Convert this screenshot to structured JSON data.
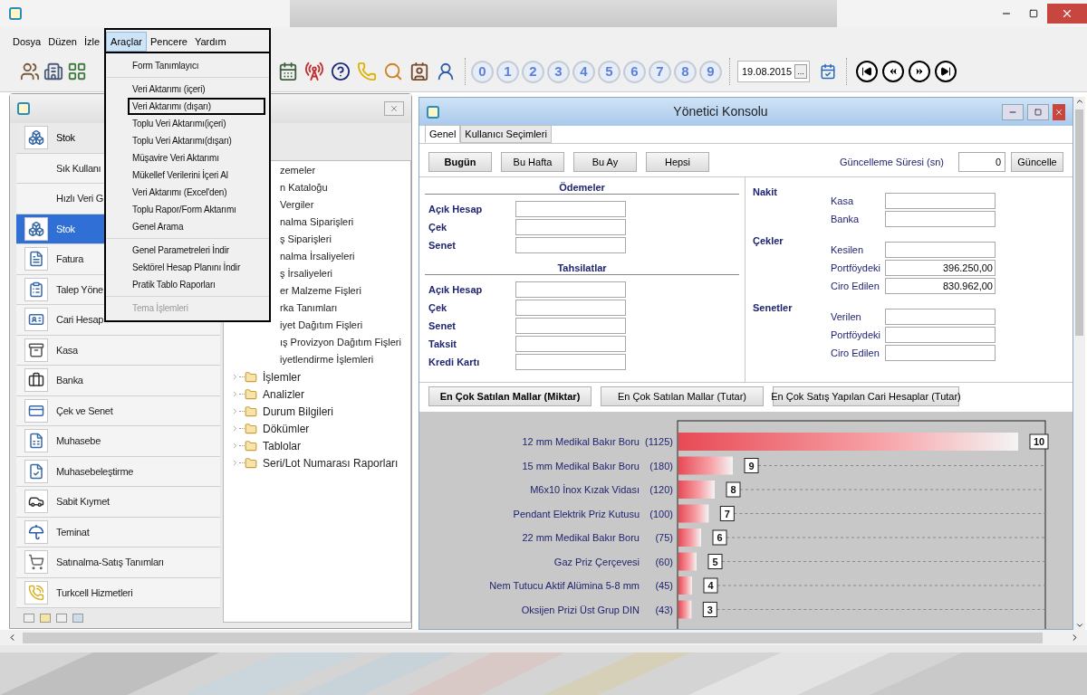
{
  "menu_bar": [
    {
      "label": "Dosya",
      "selected": false
    },
    {
      "label": "Düzen",
      "selected": false
    },
    {
      "label": "İzle",
      "selected": false
    },
    {
      "label": "Araçlar",
      "selected": true
    },
    {
      "label": "Pencere",
      "selected": false
    },
    {
      "label": "Yardım",
      "selected": false
    }
  ],
  "open_menu": {
    "groups": [
      [
        {
          "label": "Form Tanımlayıcı",
          "selected": false,
          "disabled": false
        }
      ],
      [
        {
          "label": "Veri Aktarımı (içeri)",
          "selected": false,
          "disabled": false
        },
        {
          "label": "Veri Aktarımı (dışarı)",
          "selected": true,
          "disabled": false
        },
        {
          "label": "Toplu Veri Aktarımı(içeri)",
          "selected": false,
          "disabled": false
        },
        {
          "label": "Toplu Veri Aktarımı(dışarı)",
          "selected": false,
          "disabled": false
        },
        {
          "label": "Müşavire Veri Aktarımı",
          "selected": false,
          "disabled": false
        },
        {
          "label": "Mükellef Verilerini İçeri Al",
          "selected": false,
          "disabled": false
        },
        {
          "label": "Veri Aktarımı (Excel'den)",
          "selected": false,
          "disabled": false
        },
        {
          "label": "Toplu Rapor/Form Aktarımı",
          "selected": false,
          "disabled": false
        },
        {
          "label": "Genel Arama",
          "selected": false,
          "disabled": false
        }
      ],
      [
        {
          "label": "Genel Parametreleri İndir",
          "selected": false,
          "disabled": false
        },
        {
          "label": "Sektörel Hesap Planını İndir",
          "selected": false,
          "disabled": false
        },
        {
          "label": "Pratik Tablo Raporları",
          "selected": false,
          "disabled": false
        }
      ],
      [
        {
          "label": "Tema İşlemleri",
          "selected": false,
          "disabled": true
        }
      ]
    ]
  },
  "toolbar": {
    "number_buttons": [
      "0",
      "1",
      "2",
      "3",
      "4",
      "5",
      "6",
      "7",
      "8",
      "9"
    ],
    "date": "19.08.2015",
    "date_button": "..."
  },
  "left_window": {
    "nav_items": [
      {
        "label": "Stok",
        "kind": "header",
        "selected": false
      },
      {
        "label": "Sık Kullanı",
        "kind": "plain",
        "selected": false
      },
      {
        "label": "Hızlı Veri G",
        "kind": "plain",
        "selected": false
      },
      {
        "label": "Stok",
        "kind": "module",
        "selected": true
      },
      {
        "label": "Fatura",
        "kind": "module",
        "selected": false
      },
      {
        "label": "Talep Yöne",
        "kind": "module",
        "selected": false
      },
      {
        "label": "Cari Hesap",
        "kind": "module",
        "selected": false
      },
      {
        "label": "Kasa",
        "kind": "module",
        "selected": false
      },
      {
        "label": "Banka",
        "kind": "module",
        "selected": false
      },
      {
        "label": "Çek ve Senet",
        "kind": "module",
        "selected": false
      },
      {
        "label": "Muhasebe",
        "kind": "module",
        "selected": false
      },
      {
        "label": "Muhasebeleştirme",
        "kind": "module",
        "selected": false
      },
      {
        "label": "Sabit Kıymet",
        "kind": "module",
        "selected": false
      },
      {
        "label": "Teminat",
        "kind": "module",
        "selected": false
      },
      {
        "label": "Satınalma-Satış Tanımları",
        "kind": "module",
        "selected": false
      },
      {
        "label": "Turkcell Hizmetleri",
        "kind": "module",
        "selected": false
      }
    ],
    "tree": [
      {
        "label": "zemeler",
        "kind": "clipped"
      },
      {
        "label": "n Kataloğu",
        "kind": "clipped"
      },
      {
        "label": "Vergiler",
        "kind": "clipped"
      },
      {
        "label": "nalma Siparişleri",
        "kind": "clipped"
      },
      {
        "label": "ş Siparişleri",
        "kind": "clipped"
      },
      {
        "label": "nalma İrsaliyeleri",
        "kind": "clipped"
      },
      {
        "label": "ş İrsaliyeleri",
        "kind": "clipped"
      },
      {
        "label": "er Malzeme Fişleri",
        "kind": "clipped"
      },
      {
        "label": "rka Tanımları",
        "kind": "clipped"
      },
      {
        "label": "iyet Dağıtım Fişleri",
        "kind": "clipped"
      },
      {
        "label": "ış Provizyon Dağıtım Fişleri",
        "kind": "clipped"
      },
      {
        "label": "iyetlendirme İşlemleri",
        "kind": "clipped"
      },
      {
        "label": "İşlemler",
        "kind": "folder",
        "expanded": false
      },
      {
        "label": "Analizler",
        "kind": "folder",
        "expanded": false
      },
      {
        "label": "Durum Bilgileri",
        "kind": "folder",
        "expanded": false
      },
      {
        "label": "Dökümler",
        "kind": "folder",
        "expanded": false
      },
      {
        "label": "Tablolar",
        "kind": "folder",
        "expanded": false
      },
      {
        "label": "Seri/Lot Numarası Raporları",
        "kind": "folder",
        "expanded": false
      }
    ]
  },
  "console": {
    "title": "Yönetici Konsolu",
    "tabs": [
      {
        "label": "Genel",
        "selected": true
      },
      {
        "label": "Kullanıcı Seçimleri",
        "selected": false
      }
    ],
    "period_buttons": [
      {
        "label": "Bugün",
        "selected": true
      },
      {
        "label": "Bu Hafta",
        "selected": false
      },
      {
        "label": "Bu Ay",
        "selected": false
      },
      {
        "label": "Hepsi",
        "selected": false
      }
    ],
    "refresh_label": "Güncelleme Süresi (sn)",
    "refresh_value": "0",
    "refresh_button": "Güncelle",
    "left_sections": [
      {
        "title": "Ödemeler",
        "fields": [
          {
            "label": "Açık Hesap"
          },
          {
            "label": "Çek"
          },
          {
            "label": "Senet"
          }
        ]
      },
      {
        "title": "Tahsilatlar",
        "fields": [
          {
            "label": "Açık Hesap"
          },
          {
            "label": "Çek"
          },
          {
            "label": "Senet"
          },
          {
            "label": "Taksit"
          },
          {
            "label": "Kredi Kartı"
          }
        ]
      }
    ],
    "right_groups": [
      {
        "title": "Nakit",
        "fields": [
          {
            "label": "Kasa"
          },
          {
            "label": "Banka"
          }
        ]
      },
      {
        "title": "Çekler",
        "fields": [
          {
            "label": "Kesilen"
          },
          {
            "label": "Portföydeki",
            "value": "396.250,00"
          },
          {
            "label": "Ciro Edilen",
            "value": "830.962,00"
          }
        ]
      },
      {
        "title": "Senetler",
        "fields": [
          {
            "label": "Verilen"
          },
          {
            "label": "Portföydeki"
          },
          {
            "label": "Ciro Edilen"
          }
        ]
      }
    ],
    "chart_tabs": [
      {
        "label": "En Çok Satılan Mallar (Miktar)",
        "selected": true
      },
      {
        "label": "En Çok Satılan Mallar (Tutar)",
        "selected": false
      },
      {
        "label": "En Çok Satış Yapılan Cari Hesaplar (Tutar)",
        "selected": false
      }
    ],
    "chart_data": {
      "type": "bar",
      "orientation": "horizontal",
      "categories": [
        "12 mm Medikal Bakır Boru",
        "15 mm Medikal Bakır Boru",
        "M6x10 İnox Kızak Vidası",
        "Pendant Elektrik Priz Kutusu",
        "22 mm Medikal Bakır Boru",
        "Gaz Priz Çerçevesi",
        "Nem Tutucu Aktif Alümina 5-8 mm",
        "Oksijen Prizi Üst Grup DIN"
      ],
      "values": [
        1125,
        180,
        120,
        100,
        75,
        60,
        45,
        43
      ],
      "value_labels": [
        "(1125)",
        "(180)",
        "(120)",
        "(100)",
        "(75)",
        "(60)",
        "(45)",
        "(43)"
      ],
      "annotations": [
        {
          "text": "10"
        },
        {
          "text": "9"
        },
        {
          "text": "8"
        },
        {
          "text": "7"
        },
        {
          "text": "6"
        },
        {
          "text": "5"
        },
        {
          "text": "4"
        },
        {
          "text": "3"
        }
      ]
    }
  }
}
